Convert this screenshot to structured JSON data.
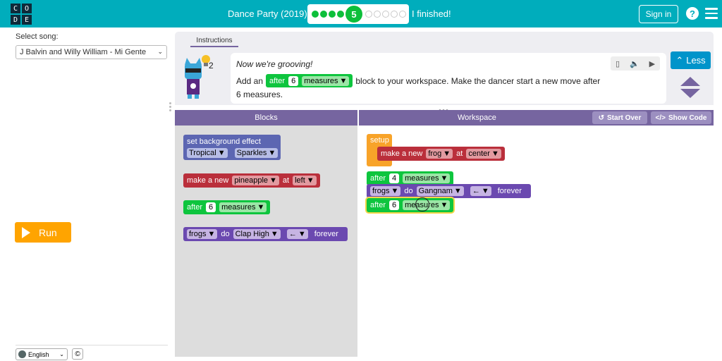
{
  "header": {
    "logo_letters": [
      "C",
      "O",
      "D",
      "E"
    ],
    "title": "Dance Party (2019)",
    "progress": {
      "current_level": "5",
      "completed": 4,
      "remaining": 6
    },
    "finished": "I finished!",
    "signin": "Sign in",
    "help": "?",
    "bg_color": "#00adbc"
  },
  "sidebar": {
    "song_label": "Select song:",
    "song_value": "J Balvin and Willy William - Mi Gente",
    "run_label": "Run",
    "language": "English",
    "copyright": "©"
  },
  "instructions": {
    "tab": "Instructions",
    "hint_count": "2",
    "line1": "Now we're grooving!",
    "line2_pre": "Add an",
    "line2_post": "block to your workspace. Make the dancer start a new move after",
    "line3": "6 measures.",
    "inline_block": {
      "after": "after",
      "num": "6",
      "measures": "measures"
    },
    "less": "Less"
  },
  "blocks_panel": {
    "title": "Blocks",
    "bg_effect": {
      "label": "set background effect",
      "opt1": "Tropical",
      "opt2": "Sparkles"
    },
    "make_new": {
      "label": "make a new",
      "sprite": "pineapple",
      "at": "at",
      "location": "left"
    },
    "after": {
      "label": "after",
      "num": "6",
      "measures": "measures"
    },
    "do": {
      "sprite": "frogs",
      "do": "do",
      "move": "Clap High",
      "dir": "←",
      "forever": "forever"
    }
  },
  "workspace": {
    "title": "Workspace",
    "start_over": "Start Over",
    "show_code": "Show Code",
    "setup": {
      "label": "setup",
      "make": "make a new",
      "sprite": "frog",
      "at": "at",
      "location": "center"
    },
    "after1": {
      "label": "after",
      "num": "4",
      "measures": "measures"
    },
    "do1": {
      "sprite": "frogs",
      "do": "do",
      "move": "Gangnam",
      "dir": "←",
      "forever": "forever"
    },
    "after2": {
      "label": "after",
      "num": "6",
      "measures": "measures"
    }
  },
  "dropdown_arrow": "▼"
}
